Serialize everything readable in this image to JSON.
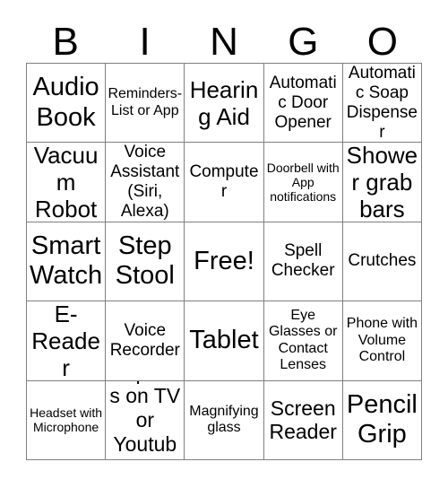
{
  "header": {
    "letters": [
      "B",
      "I",
      "N",
      "G",
      "O"
    ]
  },
  "grid": {
    "rows": [
      [
        {
          "label": "Audio Book",
          "size": "fs-xxl"
        },
        {
          "label": "Reminders-List or App",
          "size": "fs-sm"
        },
        {
          "label": "Hearing Aid",
          "size": "fs-xl"
        },
        {
          "label": "Automatic Door Opener",
          "size": "fs-md"
        },
        {
          "label": "Automatic Soap Dispenser",
          "size": "fs-md"
        }
      ],
      [
        {
          "label": "Vacuum Robot",
          "size": "fs-xl"
        },
        {
          "label": "Voice Assistant (Siri, Alexa)",
          "size": "fs-md"
        },
        {
          "label": "Computer",
          "size": "fs-md"
        },
        {
          "label": "Doorbell with App notifications",
          "size": "fs-xs"
        },
        {
          "label": "Shower grab bars",
          "size": "fs-xl"
        }
      ],
      [
        {
          "label": "Smart Watch",
          "size": "fs-xxl"
        },
        {
          "label": "Step Stool",
          "size": "fs-xxl"
        },
        {
          "label": "Free!",
          "size": "fs-xxl"
        },
        {
          "label": "Spell Checker",
          "size": "fs-md"
        },
        {
          "label": "Crutches",
          "size": "fs-md"
        }
      ],
      [
        {
          "label": "E-Reader",
          "size": "fs-xl"
        },
        {
          "label": "Voice Recorder",
          "size": "fs-md"
        },
        {
          "label": "Tablet",
          "size": "fs-xxl"
        },
        {
          "label": "Eye Glasses or Contact Lenses",
          "size": "fs-sm"
        },
        {
          "label": "Phone with Volume Control",
          "size": "fs-sm"
        }
      ],
      [
        {
          "label": "Headset with Microphone",
          "size": "fs-xs"
        },
        {
          "label": "Captions on TV or Youtube",
          "size": "fs-lg"
        },
        {
          "label": "Magnifying glass",
          "size": "fs-sm"
        },
        {
          "label": "Screen Reader",
          "size": "fs-lg"
        },
        {
          "label": "Pencil Grip",
          "size": "fs-xxl"
        }
      ]
    ]
  },
  "colors": {
    "background": "#ffffff",
    "text": "#000000",
    "gridline": "#808080"
  }
}
